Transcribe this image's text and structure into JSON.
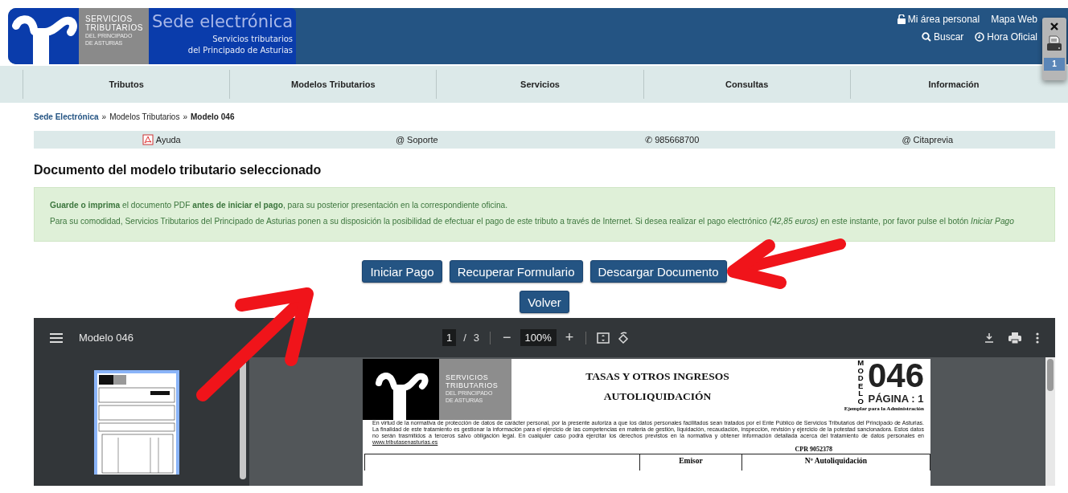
{
  "header": {
    "logo_lines": [
      "SERVICIOS",
      "TRIBUTARIOS",
      "DEL PRINCIPADO",
      "DE ASTURIAS"
    ],
    "title": "Sede electrónica",
    "subtitle_lines": [
      "Servicios tributarios",
      "del Principado de Asturias"
    ],
    "links_top": [
      "Mi área personal",
      "Mapa Web"
    ],
    "links_bottom": [
      "Buscar",
      "Hora Oficial"
    ]
  },
  "nav": [
    "Tributos",
    "Modelos Tributarios",
    "Servicios",
    "Consultas",
    "Información"
  ],
  "breadcrumb": {
    "separator": "»",
    "items": [
      {
        "label": "Sede Electrónica",
        "kind": "link"
      },
      {
        "label": "Modelos Tributarios",
        "kind": "plain"
      },
      {
        "label": "Modelo 046",
        "kind": "current"
      }
    ]
  },
  "quick_links": [
    "Ayuda",
    "@ Soporte",
    "✆ 985668700",
    "@ Citaprevia"
  ],
  "heading": "Documento del modelo tributario seleccionado",
  "notice": [
    "**Guarde o imprima** el documento PDF **antes de iniciar el pago**, para su posterior presentación en la correspondiente oficina.",
    "Para su comodidad, Servicios Tributarios del Principado de Asturias ponen a su disposición la posibilidad de efectuar el pago de este tributo a través de Internet. Si desea realizar el pago electrónico *(42,85 euros)* en este instante, por favor pulse el botón *Iniciar Pago*"
  ],
  "button_rows": [
    [
      "Iniciar Pago",
      "Recuperar Formulario",
      "Descargar Documento"
    ],
    [
      "Volver"
    ]
  ],
  "pdf_viewer": {
    "title": "Modelo 046",
    "page": "1",
    "page_separator": "/",
    "page_count": "3",
    "zoom_out": "−",
    "zoom": "100%",
    "zoom_in": "+"
  },
  "document": {
    "logo_lines": [
      "SERVICIOS",
      "TRIBUTARIOS",
      "DEL PRINCIPADO",
      "DE ASTURIAS"
    ],
    "title_lines": [
      "TASAS Y OTROS INGRESOS",
      "AUTOLIQUIDACIÓN"
    ],
    "model_label": "MODELO",
    "model_number": "046",
    "page_label": "PÁGINA : 1",
    "copy_label": "Ejemplar para la Administración",
    "privacy_text": "En virtud de la  normativa de protección de datos de carácter personal, por la presente autoriza a que los datos personales facilitados sean tratados por el Ente Público de Servicios Tributarios del Principado de Asturias. La finalidad de este tratamiento es gestionar la información para el ejercicio de las competencias en materia de gestión, liquidación, recaudación, inspección, revisión y ejercicio de la potestad sancionadora. Estos datos no serán trasmitidos a terceros salvo obligación legal. En cualquier caso podrá ejercitar los derechos previstos en la normativa y obtener información detallada acerca del tratamiento de datos personales en",
    "privacy_link": "www.tributasenasturias.es",
    "cpr": "CPR 9052378",
    "table_headers": [
      "Emisor",
      "Nº Autoliquidación"
    ]
  },
  "print_widget": {
    "badge": "1"
  }
}
